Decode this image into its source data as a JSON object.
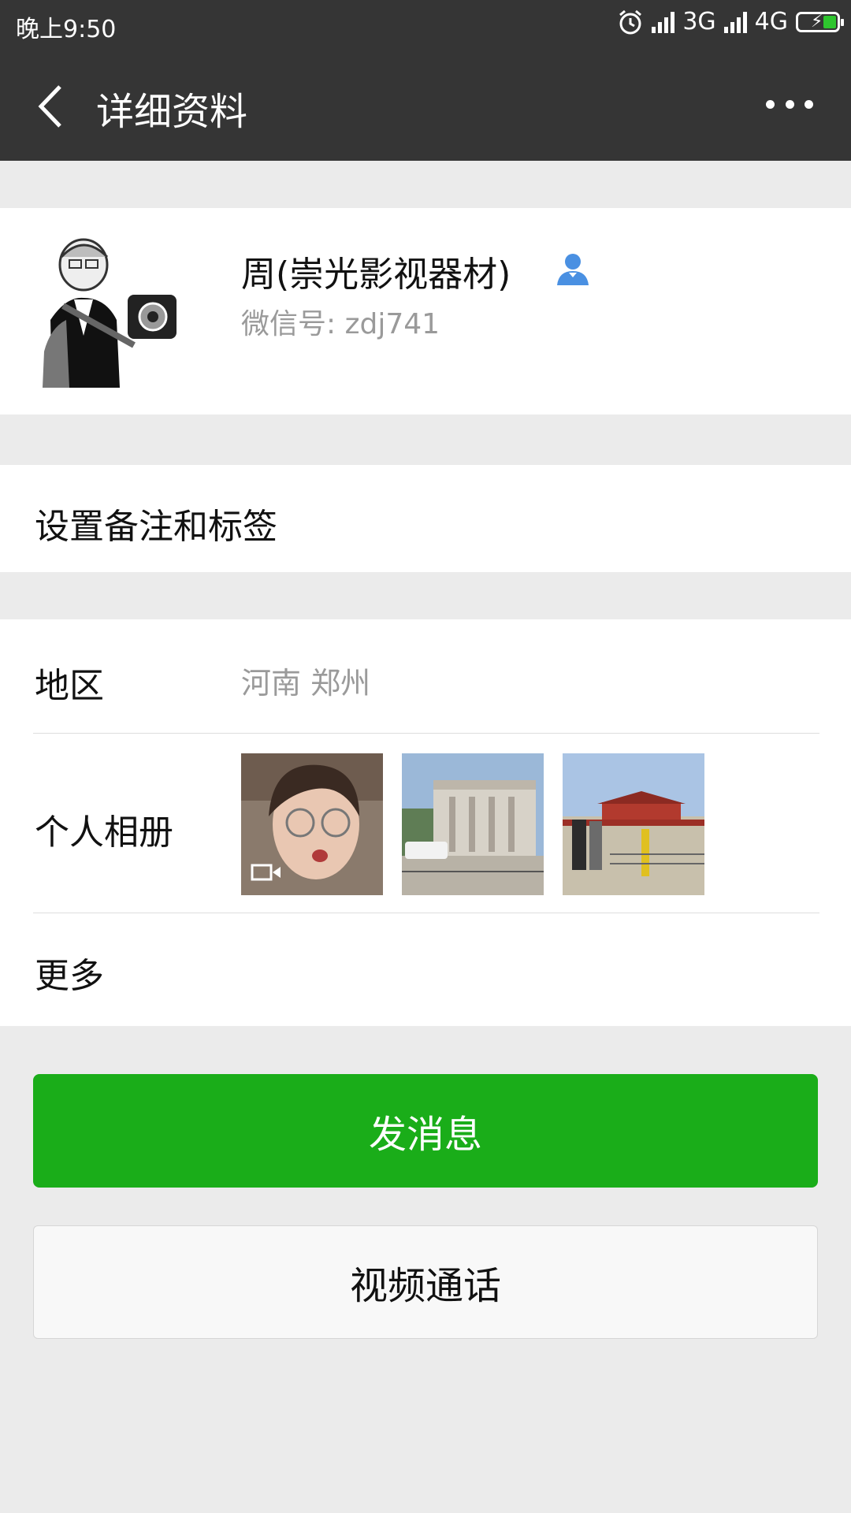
{
  "status_bar": {
    "time": "晚上9:50",
    "net1": "3G",
    "net2": "4G",
    "icons": [
      "alarm-icon",
      "signal-icon",
      "battery-charging-icon"
    ]
  },
  "nav": {
    "title": "详细资料",
    "back_icon": "chevron-left-icon",
    "more_icon": "more-dots-icon"
  },
  "profile": {
    "name": "周(崇光影视器材)",
    "wechat_id": "微信号: zdj741",
    "badge_icon": "user-icon",
    "badge_color": "#4a90e2"
  },
  "remark": {
    "label": "设置备注和标签"
  },
  "info": {
    "region_label": "地区",
    "region_value": "河南  郑州",
    "album_label": "个人相册",
    "more_label": "更多"
  },
  "buttons": {
    "send_message": "发消息",
    "video_call": "视频通话"
  },
  "colors": {
    "header_bg": "#353535",
    "primary_green": "#1aad19",
    "page_bg": "#ebebeb"
  }
}
